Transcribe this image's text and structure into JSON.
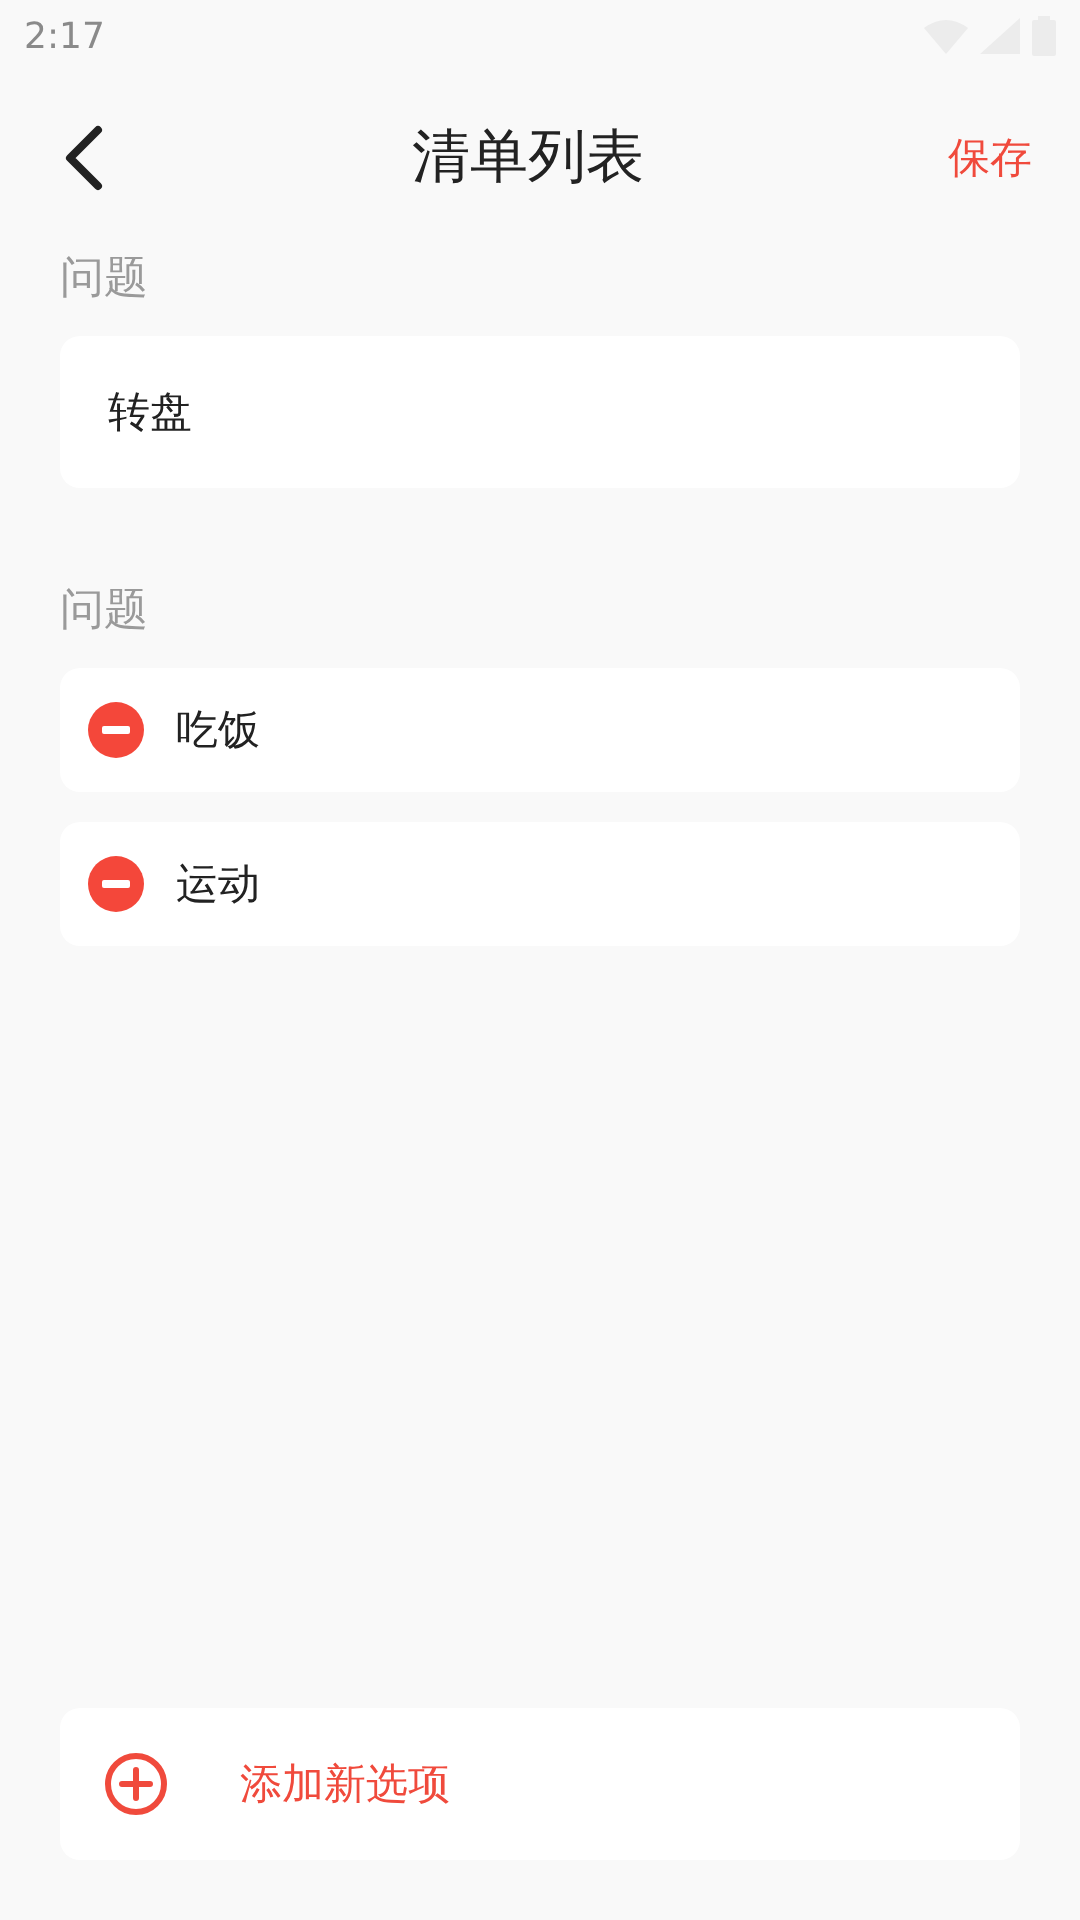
{
  "status_bar": {
    "time": "2:17"
  },
  "header": {
    "title": "清单列表",
    "action": "保存"
  },
  "title_section": {
    "label": "问题",
    "value": "转盘"
  },
  "options_section": {
    "label": "问题",
    "items": [
      {
        "text": "吃饭"
      },
      {
        "text": "运动"
      }
    ]
  },
  "add_button": {
    "label": "添加新选项"
  }
}
